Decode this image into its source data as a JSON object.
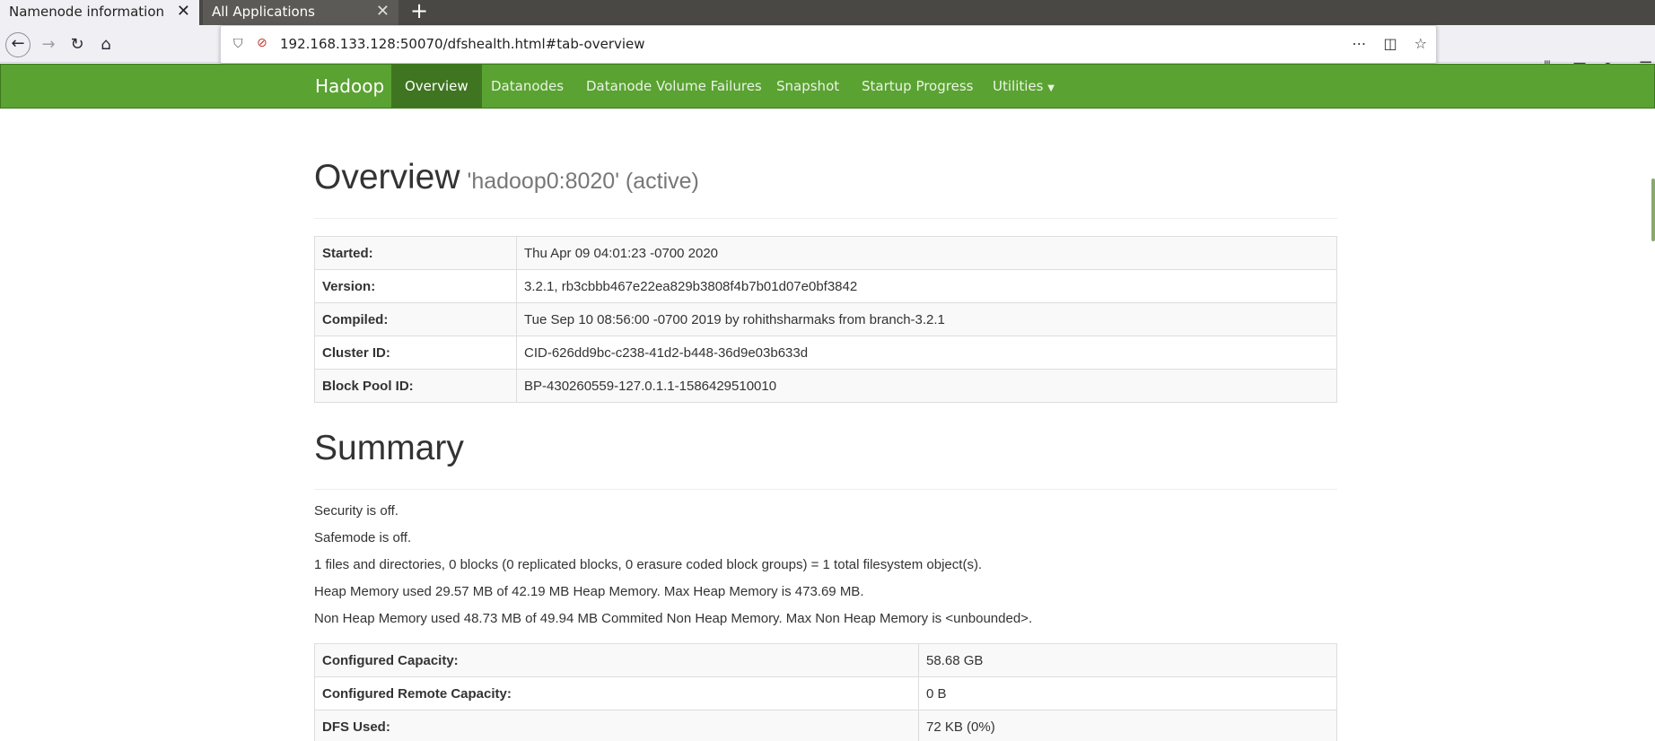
{
  "browser": {
    "tabs": [
      {
        "title": "Namenode information",
        "active": true
      },
      {
        "title": "All Applications",
        "active": false
      }
    ],
    "url": "192.168.133.128:50070/dfshealth.html#tab-overview"
  },
  "nav": {
    "brand": "Hadoop",
    "items": [
      "Overview",
      "Datanodes",
      "Datanode Volume Failures",
      "Snapshot",
      "Startup Progress",
      "Utilities"
    ],
    "active_index": 0,
    "color": "#5aa232"
  },
  "overview": {
    "title": "Overview",
    "subtitle": "'hadoop0:8020' (active)",
    "rows": [
      {
        "key": "Started:",
        "value": "Thu Apr 09 04:01:23 -0700 2020"
      },
      {
        "key": "Version:",
        "value": "3.2.1, rb3cbbb467e22ea829b3808f4b7b01d07e0bf3842"
      },
      {
        "key": "Compiled:",
        "value": "Tue Sep 10 08:56:00 -0700 2019 by rohithsharmaks from branch-3.2.1"
      },
      {
        "key": "Cluster ID:",
        "value": "CID-626dd9bc-c238-41d2-b448-36d9e03b633d"
      },
      {
        "key": "Block Pool ID:",
        "value": "BP-430260559-127.0.1.1-1586429510010"
      }
    ]
  },
  "summary": {
    "title": "Summary",
    "lines": [
      "Security is off.",
      "Safemode is off.",
      "1 files and directories, 0 blocks (0 replicated blocks, 0 erasure coded block groups) = 1 total filesystem object(s).",
      "Heap Memory used 29.57 MB of 42.19 MB Heap Memory. Max Heap Memory is 473.69 MB.",
      "Non Heap Memory used 48.73 MB of 49.94 MB Commited Non Heap Memory. Max Non Heap Memory is <unbounded>."
    ],
    "rows": [
      {
        "key": "Configured Capacity:",
        "value": "58.68 GB"
      },
      {
        "key": "Configured Remote Capacity:",
        "value": "0 B"
      },
      {
        "key": "DFS Used:",
        "value": "72 KB (0%)"
      }
    ]
  }
}
